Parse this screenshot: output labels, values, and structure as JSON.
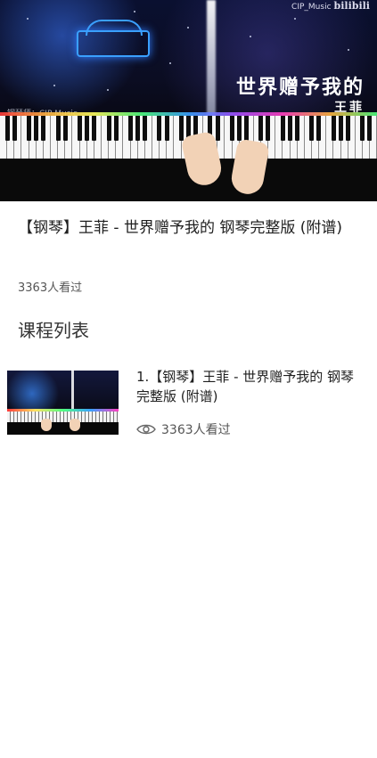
{
  "hero": {
    "watermark_channel": "CIP_Music",
    "watermark_logo": "bilibili",
    "song_title": "世界赠予我的",
    "singer": "王菲",
    "channel_caption": "钢琴师：CIP Music",
    "thumbnail_icon": "piano-video-thumbnail"
  },
  "course": {
    "title": "【钢琴】王菲 - 世界赠予我的 钢琴完整版 (附谱)",
    "views": "3363人看过"
  },
  "section": {
    "title": "课程列表"
  },
  "lessons": [
    {
      "title": "1.【钢琴】王菲 - 世界赠予我的 钢琴完整版 (附谱)",
      "views": "3363人看过",
      "icon": "eye-icon"
    }
  ]
}
